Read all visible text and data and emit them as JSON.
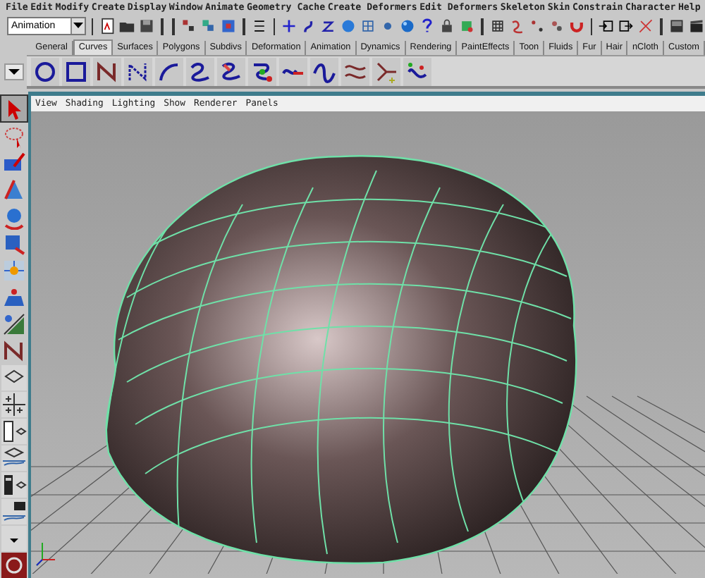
{
  "menu_bar": [
    "File",
    "Edit",
    "Modify",
    "Create",
    "Display",
    "Window",
    "Animate",
    "Geometry Cache",
    "Create Deformers",
    "Edit Deformers",
    "Skeleton",
    "Skin",
    "Constrain",
    "Character",
    "Help"
  ],
  "status_line": {
    "menu_set": "Animation"
  },
  "shelf_tabs": [
    {
      "label": "General",
      "selected": false
    },
    {
      "label": "Curves",
      "selected": true
    },
    {
      "label": "Surfaces",
      "selected": false
    },
    {
      "label": "Polygons",
      "selected": false
    },
    {
      "label": "Subdivs",
      "selected": false
    },
    {
      "label": "Deformation",
      "selected": false
    },
    {
      "label": "Animation",
      "selected": false
    },
    {
      "label": "Dynamics",
      "selected": false
    },
    {
      "label": "Rendering",
      "selected": false
    },
    {
      "label": "PaintEffects",
      "selected": false
    },
    {
      "label": "Toon",
      "selected": false
    },
    {
      "label": "Fluids",
      "selected": false
    },
    {
      "label": "Fur",
      "selected": false
    },
    {
      "label": "Hair",
      "selected": false
    },
    {
      "label": "nCloth",
      "selected": false
    },
    {
      "label": "Custom",
      "selected": false
    }
  ],
  "panel_menu": [
    "View",
    "Shading",
    "Lighting",
    "Show",
    "Renderer",
    "Panels"
  ]
}
